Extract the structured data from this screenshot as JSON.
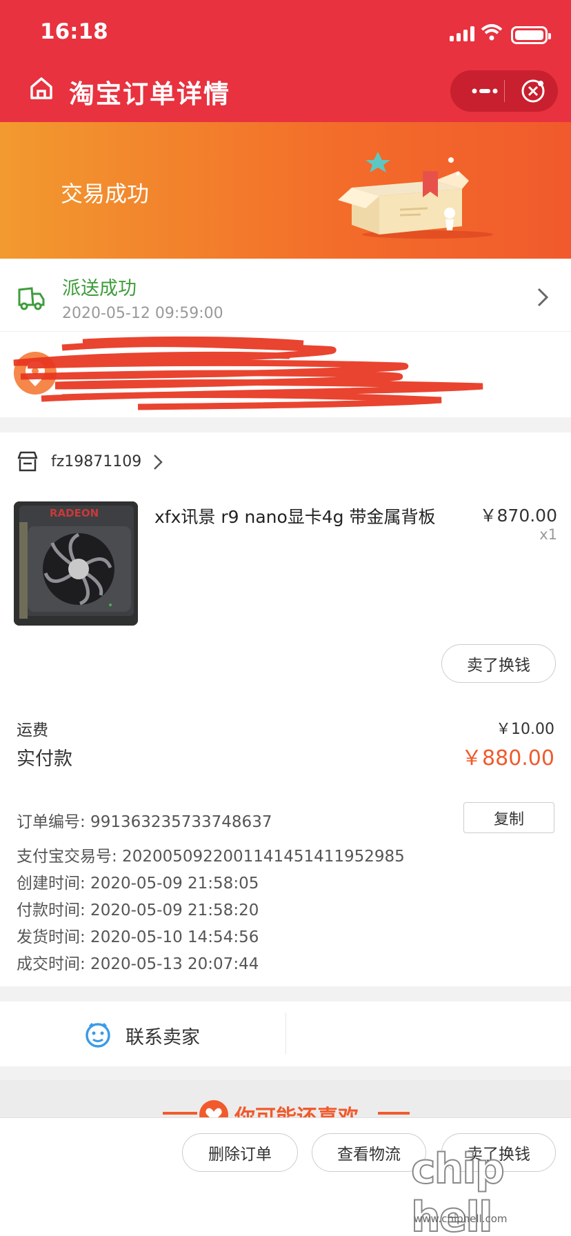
{
  "status_bar": {
    "time": "16:18"
  },
  "header": {
    "title": "淘宝订单详情",
    "more_icon": "ellipsis-icon",
    "close_icon": "target-close-icon"
  },
  "banner": {
    "text": "交易成功"
  },
  "delivery": {
    "title": "派送成功",
    "time": "2020-05-12 09:59:00"
  },
  "shop": {
    "name": "fz19871109"
  },
  "product": {
    "name": "xfx讯景 r9 nano显卡4g 带金属背板",
    "price": "￥870.00",
    "qty": "x1",
    "action": "卖了换钱"
  },
  "summary": {
    "shipping_label": "运费",
    "shipping_value": "￥10.00",
    "paid_label": "实付款",
    "paid_value": "￥880.00"
  },
  "order_info": {
    "order_no": "订单编号:  991363235733748637",
    "copy": "复制",
    "alipay_no": "支付宝交易号:  2020050922001141451411952985",
    "created": "创建时间:  2020-05-09 21:58:05",
    "paid": "付款时间:  2020-05-09 21:58:20",
    "shipped": "发货时间:  2020-05-10 14:54:56",
    "closed": "成交时间:  2020-05-13 20:07:44"
  },
  "contact": {
    "label": "联系卖家"
  },
  "recommend": {
    "title": "你可能还喜欢"
  },
  "bottom_bar": {
    "delete": "删除订单",
    "logistics": "查看物流",
    "sell": "卖了换钱"
  },
  "watermark": {
    "logo": "chip hell",
    "url": "www.chiphell.com"
  },
  "colors": {
    "header": "#e8323f",
    "accent": "#f15a2c",
    "delivered": "#3e9c3b"
  }
}
